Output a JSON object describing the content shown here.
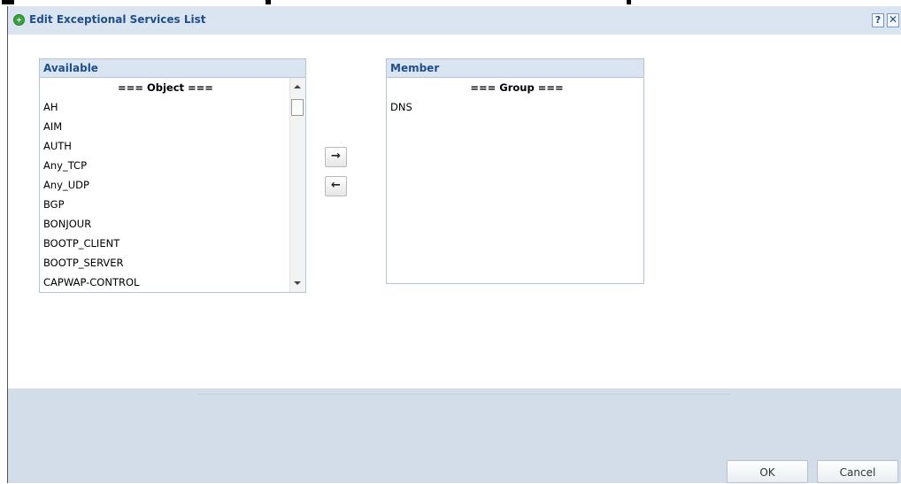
{
  "dialog": {
    "title": "Edit Exceptional Services List",
    "help_label": "?",
    "close_label": "✕"
  },
  "available": {
    "header": "Available",
    "items": [
      "=== Object ===",
      "AH",
      "AIM",
      "AUTH",
      "Any_TCP",
      "Any_UDP",
      "BGP",
      "BONJOUR",
      "BOOTP_CLIENT",
      "BOOTP_SERVER",
      "CAPWAP-CONTROL"
    ]
  },
  "member": {
    "header": "Member",
    "items": [
      "=== Group ===",
      "DNS"
    ]
  },
  "move": {
    "add_label": "→",
    "remove_label": "←"
  },
  "footer": {
    "ok_label": "OK",
    "cancel_label": "Cancel"
  }
}
